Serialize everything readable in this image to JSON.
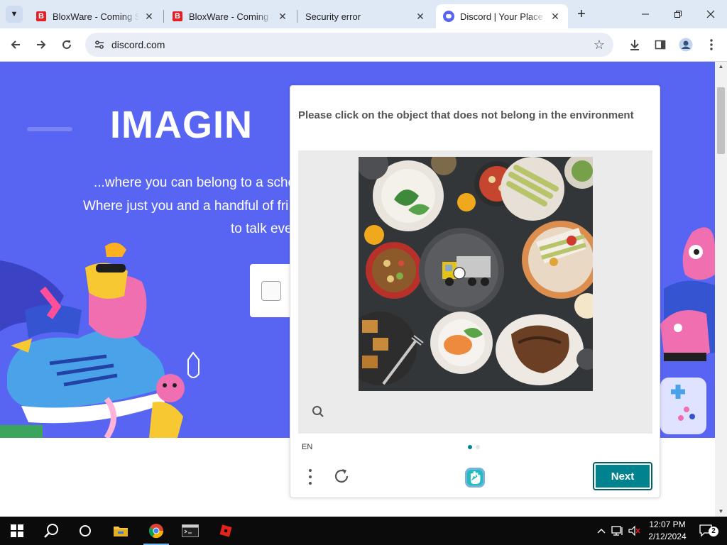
{
  "browser": {
    "tabs": [
      {
        "title": "BloxWare - Coming Soon",
        "favicon": "bloxware-favicon",
        "active": false
      },
      {
        "title": "BloxWare - Coming Soon",
        "favicon": "bloxware-favicon",
        "active": false
      },
      {
        "title": "Security error",
        "favicon": "none",
        "active": false
      },
      {
        "title": "Discord | Your Place to Talk",
        "favicon": "discord-favicon",
        "active": true
      }
    ],
    "url": "discord.com"
  },
  "hero": {
    "heading": "IMAGIN",
    "line1": "...where you can belong to a scho",
    "line2": "Where just you and a handful of fri",
    "line3": "to talk eve"
  },
  "captcha": {
    "prompt": "Please click on the object that does not belong in the environment",
    "language": "EN",
    "next_label": "Next",
    "page_indicator": {
      "total": 2,
      "current": 1
    }
  },
  "taskbar": {
    "time": "12:07 PM",
    "date": "2/12/2024",
    "notification_count": "2"
  },
  "colors": {
    "discord_blurple": "#5865f2",
    "captcha_accent": "#00838f",
    "tab_strip": "#dfe8f5"
  }
}
